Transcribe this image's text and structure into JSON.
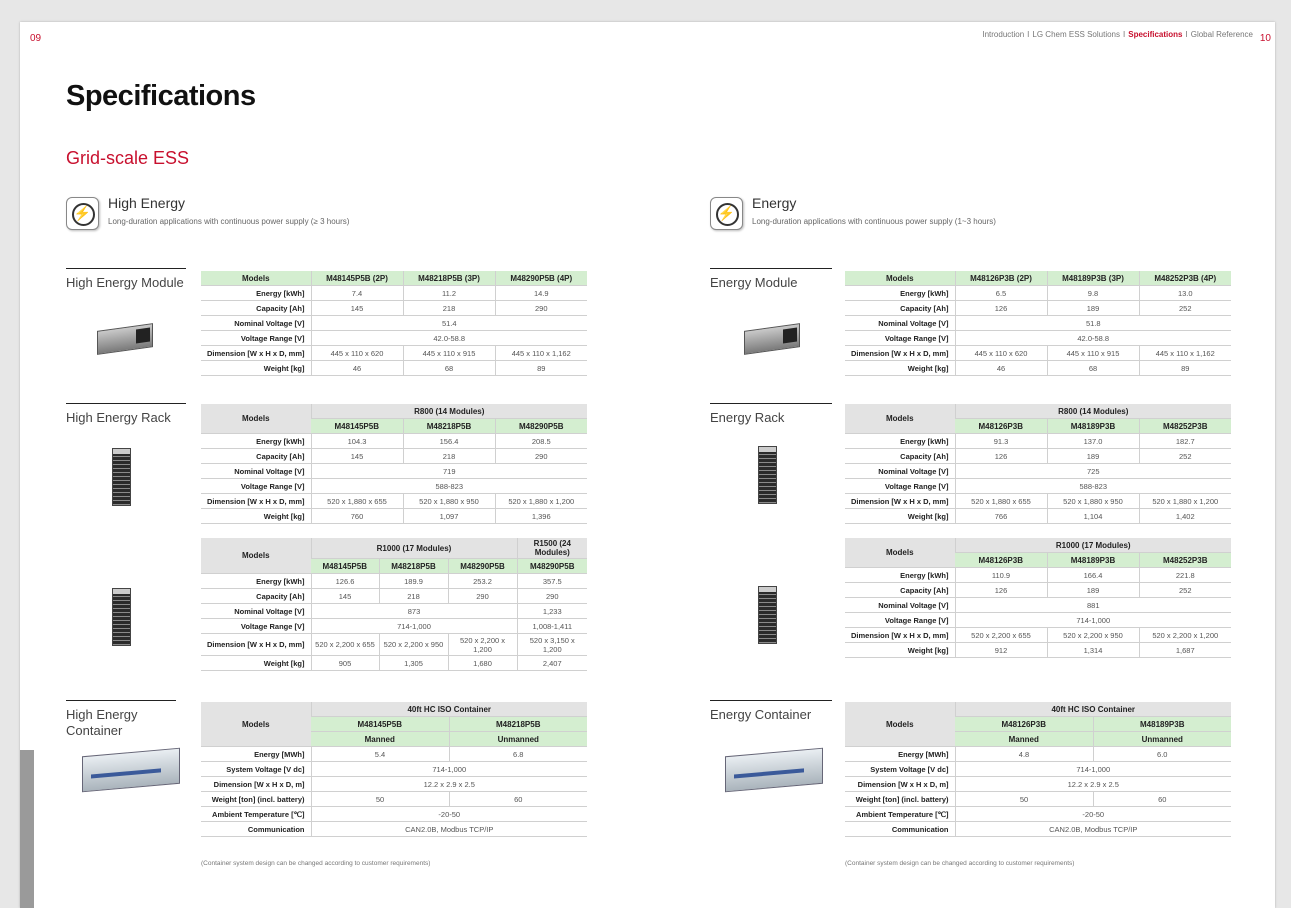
{
  "page_left_num": "09",
  "page_right_num": "10",
  "nav": {
    "items": [
      "Introduction",
      "LG Chem ESS Solutions",
      "Specifications",
      "Global Reference"
    ],
    "separator": "I",
    "active_index": 2
  },
  "title": "Specifications",
  "subtitle": "Grid-scale ESS",
  "left": {
    "category": {
      "title": "High Energy",
      "desc": "Long-duration applications with continuous power supply (≥ 3 hours)"
    },
    "module": {
      "section": "High Energy Module",
      "header": [
        "Models",
        "M48145P5B (2P)",
        "M48218P5B (3P)",
        "M48290P5B (4P)"
      ],
      "rows": [
        [
          "Energy [kWh]",
          "7.4",
          "11.2",
          "14.9"
        ],
        [
          "Capacity [Ah]",
          "145",
          "218",
          "290"
        ],
        [
          "Nominal Voltage [V]",
          "51.4"
        ],
        [
          "Voltage Range [V]",
          "42.0-58.8"
        ],
        [
          "Dimension [W x H x D, mm]",
          "445 x 110 x 620",
          "445 x 110 x 915",
          "445 x 110 x 1,162"
        ],
        [
          "Weight [kg]",
          "46",
          "68",
          "89"
        ]
      ]
    },
    "rack": {
      "section": "High Energy Rack",
      "t1": {
        "models_label": "Models",
        "group": "R800 (14 Modules)",
        "models": [
          "M48145P5B",
          "M48218P5B",
          "M48290P5B"
        ],
        "rows": [
          [
            "Energy [kWh]",
            "104.3",
            "156.4",
            "208.5"
          ],
          [
            "Capacity [Ah]",
            "145",
            "218",
            "290"
          ],
          [
            "Nominal Voltage [V]",
            "719"
          ],
          [
            "Voltage Range [V]",
            "588-823"
          ],
          [
            "Dimension [W x H x D, mm]",
            "520 x 1,880 x 655",
            "520 x 1,880 x 950",
            "520 x 1,880 x 1,200"
          ],
          [
            "Weight [kg]",
            "760",
            "1,097",
            "1,396"
          ]
        ]
      },
      "t2": {
        "models_label": "Models",
        "group": "R1000 (17 Modules)",
        "group2": "R1500 (24 Modules)",
        "models": [
          "M48145P5B",
          "M48218P5B",
          "M48290P5B",
          "M48290P5B"
        ],
        "rows": [
          [
            "Energy [kWh]",
            "126.6",
            "189.9",
            "253.2",
            "357.5"
          ],
          [
            "Capacity [Ah]",
            "145",
            "218",
            "290",
            "290"
          ],
          [
            "Nominal Voltage [V]",
            "873",
            "1,233"
          ],
          [
            "Voltage Range [V]",
            "714-1,000",
            "1,008-1,411"
          ],
          [
            "Dimension [W x H x D, mm]",
            "520 x 2,200 x 655",
            "520 x 2,200 x 950",
            "520 x 2,200 x 1,200",
            "520 x 3,150 x 1,200"
          ],
          [
            "Weight [kg]",
            "905",
            "1,305",
            "1,680",
            "2,407"
          ]
        ]
      }
    },
    "container": {
      "section": "High Energy Container",
      "models_label": "Models",
      "group": "40ft HC ISO Container",
      "models": [
        "M48145P5B",
        "M48218P5B"
      ],
      "types": [
        "Manned",
        "Unmanned"
      ],
      "rows": [
        [
          "Energy [MWh]",
          "5.4",
          "6.8"
        ],
        [
          "System Voltage [V dc]",
          "714-1,000"
        ],
        [
          "Dimension [W x H x D, m]",
          "12.2 x 2.9 x 2.5"
        ],
        [
          "Weight [ton] (incl. battery)",
          "50",
          "60"
        ],
        [
          "Ambient Temperature [℃]",
          "-20-50"
        ],
        [
          "Communication",
          "CAN2.0B, Modbus TCP/IP"
        ]
      ],
      "note": "(Container system design can be changed according to customer requirements)"
    }
  },
  "right": {
    "category": {
      "title": "Energy",
      "desc": "Long-duration applications with continuous power supply (1~3 hours)"
    },
    "module": {
      "section": "Energy Module",
      "header": [
        "Models",
        "M48126P3B (2P)",
        "M48189P3B (3P)",
        "M48252P3B (4P)"
      ],
      "rows": [
        [
          "Energy [kWh]",
          "6.5",
          "9.8",
          "13.0"
        ],
        [
          "Capacity [Ah]",
          "126",
          "189",
          "252"
        ],
        [
          "Nominal Voltage [V]",
          "51.8"
        ],
        [
          "Voltage Range [V]",
          "42.0-58.8"
        ],
        [
          "Dimension [W x H x D, mm]",
          "445 x 110 x 620",
          "445 x 110 x 915",
          "445 x 110 x 1,162"
        ],
        [
          "Weight [kg]",
          "46",
          "68",
          "89"
        ]
      ]
    },
    "rack": {
      "section": "Energy Rack",
      "t1": {
        "models_label": "Models",
        "group": "R800 (14 Modules)",
        "models": [
          "M48126P3B",
          "M48189P3B",
          "M48252P3B"
        ],
        "rows": [
          [
            "Energy [kWh]",
            "91.3",
            "137.0",
            "182.7"
          ],
          [
            "Capacity [Ah]",
            "126",
            "189",
            "252"
          ],
          [
            "Nominal Voltage [V]",
            "725"
          ],
          [
            "Voltage Range [V]",
            "588-823"
          ],
          [
            "Dimension [W x H x D, mm]",
            "520 x 1,880 x 655",
            "520 x 1,880 x 950",
            "520 x 1,880 x 1,200"
          ],
          [
            "Weight [kg]",
            "766",
            "1,104",
            "1,402"
          ]
        ]
      },
      "t2": {
        "models_label": "Models",
        "group": "R1000 (17 Modules)",
        "models": [
          "M48126P3B",
          "M48189P3B",
          "M48252P3B"
        ],
        "rows": [
          [
            "Energy [kWh]",
            "110.9",
            "166.4",
            "221.8"
          ],
          [
            "Capacity [Ah]",
            "126",
            "189",
            "252"
          ],
          [
            "Nominal Voltage [V]",
            "881"
          ],
          [
            "Voltage Range [V]",
            "714-1,000"
          ],
          [
            "Dimension [W x H x D, mm]",
            "520 x 2,200 x 655",
            "520 x 2,200 x 950",
            "520 x 2,200 x 1,200"
          ],
          [
            "Weight [kg]",
            "912",
            "1,314",
            "1,687"
          ]
        ]
      }
    },
    "container": {
      "section": "Energy Container",
      "models_label": "Models",
      "group": "40ft HC ISO Container",
      "models": [
        "M48126P3B",
        "M48189P3B"
      ],
      "types": [
        "Manned",
        "Unmanned"
      ],
      "rows": [
        [
          "Energy [MWh]",
          "4.8",
          "6.0"
        ],
        [
          "System Voltage [V dc]",
          "714-1,000"
        ],
        [
          "Dimension [W x H x D, m]",
          "12.2 x 2.9 x 2.5"
        ],
        [
          "Weight [ton] (incl. battery)",
          "50",
          "60"
        ],
        [
          "Ambient Temperature [℃]",
          "-20-50"
        ],
        [
          "Communication",
          "CAN2.0B, Modbus TCP/IP"
        ]
      ],
      "note": "(Container system design can be changed according to customer requirements)"
    }
  }
}
